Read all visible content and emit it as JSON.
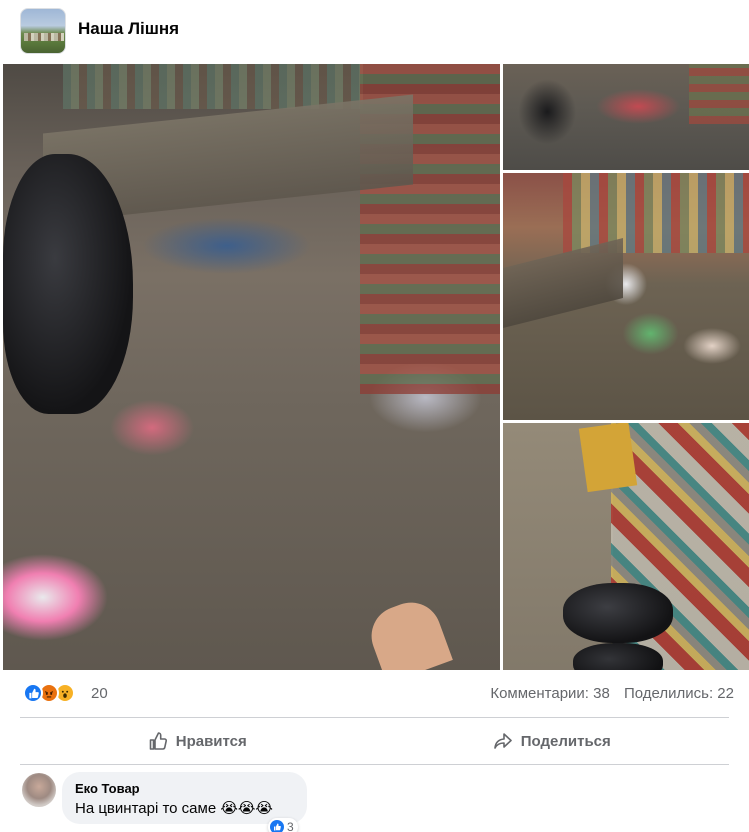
{
  "group": {
    "name": "Наша Лішня",
    "avatar_icon": "group-cover-thumbnail"
  },
  "post": {
    "photos": [
      {
        "id": "main",
        "description_icon": "photo-trash-bus-stop"
      },
      {
        "id": "top-right",
        "description_icon": "photo-trash-corner"
      },
      {
        "id": "middle-right",
        "description_icon": "photo-trash-bench"
      },
      {
        "id": "bottom-right",
        "description_icon": "photo-trash-bags-mosaic"
      }
    ]
  },
  "stats": {
    "reactions": [
      "like-icon",
      "angry-icon",
      "wow-icon"
    ],
    "reaction_count": "20",
    "comments": "Комментарии: 38",
    "shares": "Поделились: 22"
  },
  "actions": {
    "like_label": "Нравится",
    "share_label": "Поделиться"
  },
  "comment": {
    "author": "Еко Товар",
    "text": "На цвинтарі то саме 😭😭😭",
    "reaction_count": "3",
    "reaction_icon": "like-icon"
  },
  "colors": {
    "accent": "#1877f2",
    "secondary_text": "#65676b",
    "divider": "#ced0d4",
    "bubble": "#f0f2f5"
  }
}
